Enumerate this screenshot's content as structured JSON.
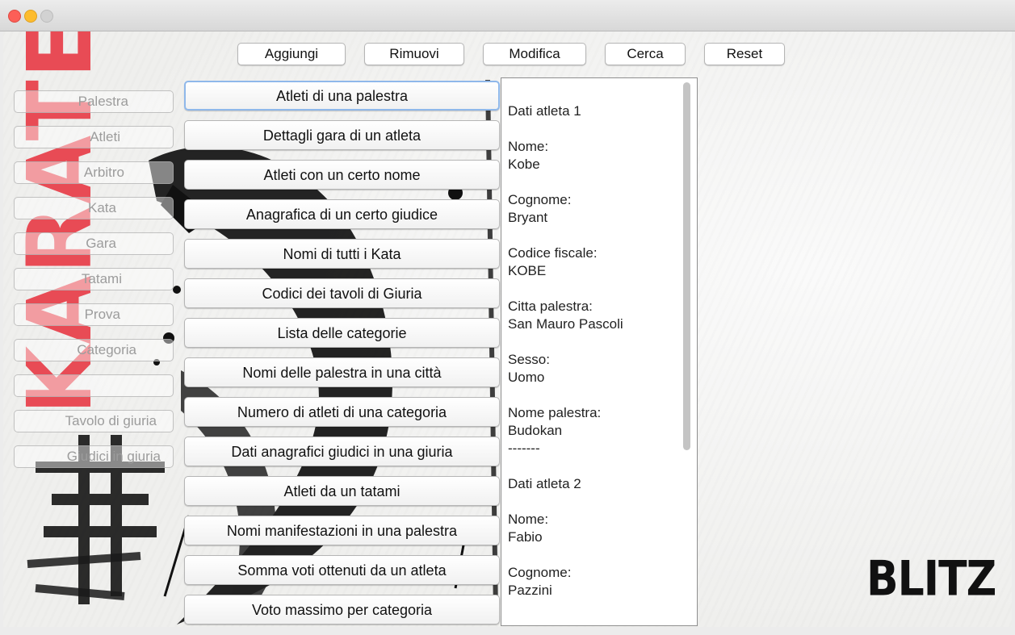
{
  "window": {
    "title": ""
  },
  "toolbar": {
    "buttons": [
      "Aggiungi",
      "Rimuovi",
      "Modifica",
      "Cerca",
      "Reset"
    ]
  },
  "sidebar": {
    "items": [
      "Palestra",
      "Atleti",
      "Arbitro",
      "Kata",
      "Gara",
      "Tatami",
      "Prova",
      "Categoria",
      "",
      "Tavolo di giuria",
      "Giudici in giuria"
    ]
  },
  "queries": [
    "Atleti di una palestra",
    "Dettagli gara di un atleta",
    "Atleti con un certo nome",
    "Anagrafica di un certo giudice",
    "Nomi di tutti i Kata",
    "Codici dei tavoli di Giuria",
    "Lista delle categorie",
    "Nomi delle palestra in una città",
    "Numero di atleti di una categoria",
    "Dati anagrafici giudici in una giuria",
    "Atleti da un tatami",
    "Nomi manifestazioni in una palestra",
    "Somma voti ottenuti da un atleta",
    "Voto massimo per categoria"
  ],
  "result": {
    "text": "Dati atleta 1\n\nNome:\nKobe\n\nCognome:\nBryant\n\nCodice fiscale:\nKOBE\n\nCitta palestra:\nSan Mauro Pascoli\n\nSesso:\nUomo\n\nNome palestra:\nBudokan\n-------\n\nDati atleta 2\n\nNome:\nFabio\n\nCognome:\nPazzini"
  },
  "branding": {
    "side_word": "KARATE",
    "logo": "BLITZ"
  },
  "colors": {
    "accent_red": "#e84b55",
    "focus_ring": "#8fb8ea"
  }
}
